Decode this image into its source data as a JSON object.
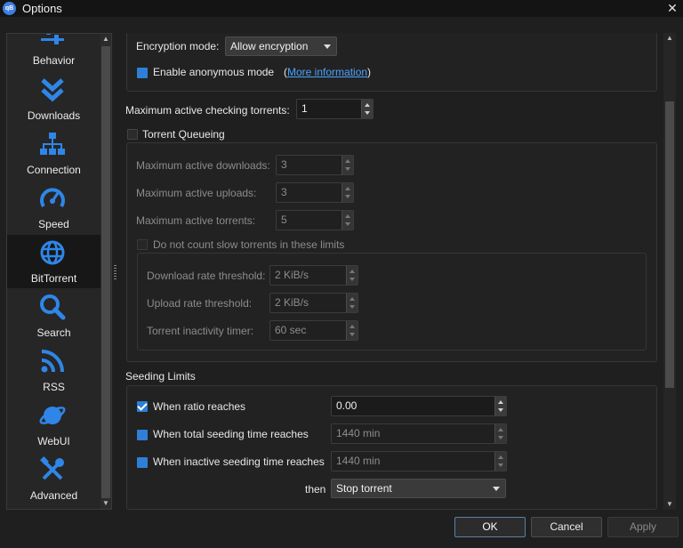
{
  "window": {
    "title": "Options",
    "icon_text": "qB",
    "close_glyph": "✕"
  },
  "sidebar": {
    "items": [
      {
        "label": "Behavior",
        "icon": "sliders-icon"
      },
      {
        "label": "Downloads",
        "icon": "chevrons-down-icon"
      },
      {
        "label": "Connection",
        "icon": "network-icon"
      },
      {
        "label": "Speed",
        "icon": "speedometer-icon"
      },
      {
        "label": "BitTorrent",
        "icon": "globe-icon"
      },
      {
        "label": "Search",
        "icon": "magnifier-icon"
      },
      {
        "label": "RSS",
        "icon": "rss-icon"
      },
      {
        "label": "WebUI",
        "icon": "planet-icon"
      },
      {
        "label": "Advanced",
        "icon": "tools-icon"
      }
    ],
    "selected": "BitTorrent"
  },
  "privacy": {
    "encryption_label": "Encryption mode:",
    "encryption_value": "Allow encryption",
    "anonymous_label": "Enable anonymous mode",
    "more_info_open": "(",
    "more_info_link": "More information",
    "more_info_close": ")"
  },
  "checking": {
    "label": "Maximum active checking torrents:",
    "value": "1"
  },
  "queueing": {
    "label": "Torrent Queueing",
    "downloads_label": "Maximum active downloads:",
    "downloads_value": "3",
    "uploads_label": "Maximum active uploads:",
    "uploads_value": "3",
    "torrents_label": "Maximum active torrents:",
    "torrents_value": "5",
    "slow_label": "Do not count slow torrents in these limits",
    "dl_threshold_label": "Download rate threshold:",
    "dl_threshold_value": "2 KiB/s",
    "ul_threshold_label": "Upload rate threshold:",
    "ul_threshold_value": "2 KiB/s",
    "inactivity_label": "Torrent inactivity timer:",
    "inactivity_value": "60 sec"
  },
  "seeding": {
    "title": "Seeding Limits",
    "ratio_label": "When ratio reaches",
    "ratio_value": "0.00",
    "total_label": "When total seeding time reaches",
    "total_value": "1440 min",
    "inactive_label": "When inactive seeding time reaches",
    "inactive_value": "1440 min",
    "then_label": "then",
    "then_value": "Stop torrent"
  },
  "buttons": {
    "ok": "OK",
    "cancel": "Cancel",
    "apply": "Apply"
  },
  "colors": {
    "accent": "#2f7fd8",
    "link": "#4aa3ff",
    "icon_blue": "#2f86e8"
  }
}
